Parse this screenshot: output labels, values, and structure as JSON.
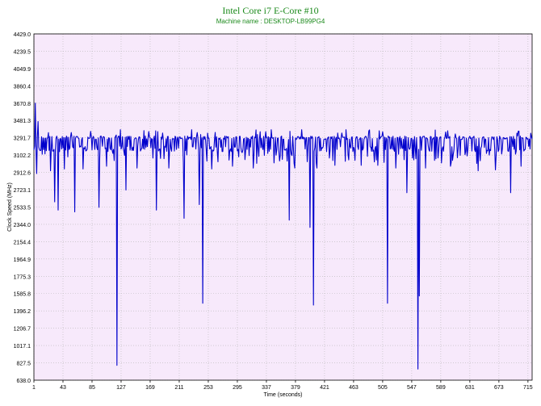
{
  "chart_data": {
    "type": "line",
    "title": "Intel Core i7 E-Core #10",
    "subtitle": "Machine name : DESKTOP-LB99PG4",
    "xlabel": "Time (seconds)",
    "ylabel": "Clock Speed (MHz)",
    "xlim": [
      1,
      721
    ],
    "ylim": [
      638.0,
      4429.0
    ],
    "y_ticks": [
      "4429.0",
      "4239.5",
      "4049.9",
      "3860.4",
      "3670.8",
      "3481.3",
      "3291.7",
      "3102.2",
      "2912.6",
      "2723.1",
      "2533.5",
      "2344.0",
      "2154.4",
      "1964.9",
      "1775.3",
      "1585.8",
      "1396.2",
      "1206.7",
      "1017.1",
      "827.5",
      "638.0"
    ],
    "x_ticks": [
      "1",
      "43",
      "85",
      "127",
      "169",
      "211",
      "253",
      "295",
      "337",
      "379",
      "421",
      "463",
      "505",
      "547",
      "589",
      "631",
      "673",
      "715"
    ],
    "grid": true,
    "series": [
      {
        "color": "#0000cc",
        "baseline": 3291.7,
        "dips": [
          [
            3,
            3670.8
          ],
          [
            5,
            2900
          ],
          [
            7,
            3470
          ],
          [
            25,
            2930
          ],
          [
            31,
            2590
          ],
          [
            36,
            2500
          ],
          [
            45,
            2950
          ],
          [
            60,
            2480
          ],
          [
            72,
            2950
          ],
          [
            95,
            2530
          ],
          [
            106,
            2980
          ],
          [
            121,
            800
          ],
          [
            126,
            3380
          ],
          [
            134,
            2720
          ],
          [
            150,
            2960
          ],
          [
            160,
            3370
          ],
          [
            178,
            2500
          ],
          [
            196,
            2960
          ],
          [
            218,
            2410
          ],
          [
            229,
            3380
          ],
          [
            240,
            2560
          ],
          [
            245,
            1480
          ],
          [
            258,
            2950
          ],
          [
            288,
            2980
          ],
          [
            318,
            2960
          ],
          [
            344,
            3380
          ],
          [
            370,
            2390
          ],
          [
            378,
            2960
          ],
          [
            388,
            3380
          ],
          [
            400,
            2310
          ],
          [
            405,
            1460
          ],
          [
            410,
            2960
          ],
          [
            436,
            2990
          ],
          [
            452,
            3380
          ],
          [
            474,
            2990
          ],
          [
            498,
            2990
          ],
          [
            512,
            1480
          ],
          [
            524,
            2960
          ],
          [
            540,
            2690
          ],
          [
            556,
            760
          ],
          [
            558,
            1560
          ],
          [
            567,
            2960
          ],
          [
            603,
            2980
          ],
          [
            643,
            2930
          ],
          [
            668,
            2940
          ],
          [
            690,
            2690
          ],
          [
            705,
            2980
          ]
        ]
      }
    ]
  }
}
